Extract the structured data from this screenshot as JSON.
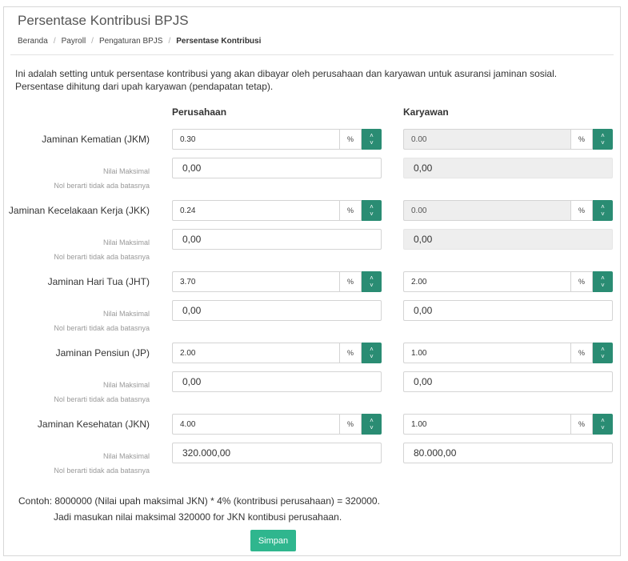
{
  "page": {
    "title": "Persentase Kontribusi BPJS",
    "breadcrumb": [
      "Beranda",
      "Payroll",
      "Pengaturan BPJS",
      "Persentase Kontribusi"
    ],
    "intro_line1": "Ini adalah setting untuk persentase kontribusi yang akan dibayar oleh perusahaan dan karyawan untuk asuransi jaminan sosial.",
    "intro_line2": "Persentase dihitung dari upah karyawan (pendapatan tetap).",
    "col_company": "Perusahaan",
    "col_employee": "Karyawan",
    "max_label": "Nilai Maksimal",
    "max_hint": "Nol berarti tidak ada batasnya",
    "pct_symbol": "%",
    "example_line1": "Contoh: 8000000 (Nilai upah maksimal JKN) * 4% (kontribusi perusahaan) = 320000.",
    "example_line2": "Jadi masukan nilai maksimal 320000 for JKN kontibusi perusahaan.",
    "save_label": "Simpan"
  },
  "rows": [
    {
      "label": "Jaminan Kematian (JKM)",
      "company_pct": "0.30",
      "employee_pct": "0.00",
      "company_max": "0,00",
      "employee_max": "0,00",
      "employee_disabled": true
    },
    {
      "label": "Jaminan Kecelakaan Kerja (JKK)",
      "company_pct": "0.24",
      "employee_pct": "0.00",
      "company_max": "0,00",
      "employee_max": "0,00",
      "employee_disabled": true
    },
    {
      "label": "Jaminan Hari Tua (JHT)",
      "company_pct": "3.70",
      "employee_pct": "2.00",
      "company_max": "0,00",
      "employee_max": "0,00",
      "employee_disabled": false
    },
    {
      "label": "Jaminan Pensiun (JP)",
      "company_pct": "2.00",
      "employee_pct": "1.00",
      "company_max": "0,00",
      "employee_max": "0,00",
      "employee_disabled": false
    },
    {
      "label": "Jaminan Kesehatan (JKN)",
      "company_pct": "4.00",
      "employee_pct": "1.00",
      "company_max": "320.000,00",
      "employee_max": "80.000,00",
      "employee_disabled": false
    }
  ],
  "colors": {
    "spinner": "#2a8c73",
    "save_button": "#2fb68e",
    "disabled_bg": "#eeeeee"
  },
  "icons": {
    "spinner": "chevron-up-down-icon"
  }
}
